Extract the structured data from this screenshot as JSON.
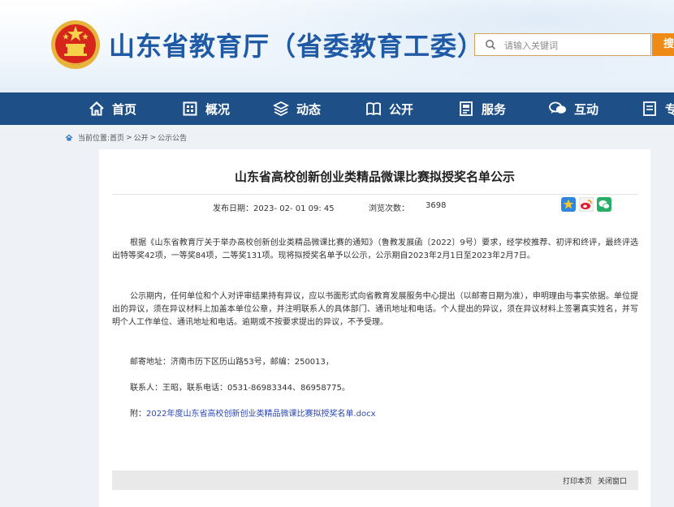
{
  "header": {
    "site_title": "山东省教育厅（省委教育工委）",
    "search_placeholder": "请输入关键词",
    "search_button": "搜"
  },
  "nav": {
    "items": [
      {
        "label": "首页",
        "icon": "home-icon"
      },
      {
        "label": "概况",
        "icon": "building-icon"
      },
      {
        "label": "动态",
        "icon": "layers-icon"
      },
      {
        "label": "公开",
        "icon": "book-icon"
      },
      {
        "label": "服务",
        "icon": "document-icon"
      },
      {
        "label": "互动",
        "icon": "chat-icon"
      },
      {
        "label": "专",
        "icon": "list-icon"
      }
    ]
  },
  "breadcrumb": {
    "prefix": "当前位置:",
    "items": [
      "首页",
      "公开",
      "公示公告"
    ],
    "separator": ">"
  },
  "article": {
    "title": "山东省高校创新创业类精品微课比赛拟授奖名单公示",
    "publish_label": "发布日期：",
    "publish_date": "2023- 02- 01 09: 45",
    "views_label": "浏览次数：",
    "views": "3698",
    "share_icons": [
      "qzone-icon",
      "weibo-icon",
      "wechat-icon"
    ],
    "para1": "根据《山东省教育厅关于举办高校创新创业类精品微课比赛的通知》（鲁教发展函〔2022〕9号）要求，经学校推荐、初评和终评，最终评选出特等奖42项，一等奖84项，二等奖131项。现将拟授奖名单予以公示，公示期自2023年2月1日至2023年2月7日。",
    "para2": "公示期内，任何单位和个人对评审结果持有异议，应以书面形式向省教育发展服务中心提出（以邮寄日期为准），申明理由与事实依据。单位提出的异议，须在异议材料上加盖本单位公章，并注明联系人的具体部门、通讯地址和电话。个人提出的异议，须在异议材料上签署真实姓名，并写明个人工作单位、通讯地址和电话。逾期或不按要求提出的异议，不予受理。",
    "mail": "邮寄地址：济南市历下区历山路53号，邮编：250013，",
    "contact": "联系人：王昭，联系电话：0531-86983344、86958775。",
    "attach_prefix": "附：",
    "attach_link": "2022年度山东省高校创新创业类精品微课比赛拟授奖名单.docx",
    "print_label": "打印本页",
    "close_label": "关闭窗口"
  },
  "colors": {
    "nav_bg": "#1e4f86",
    "title_blue": "#1f5aa6",
    "search_orange": "#f08a16",
    "link_blue": "#2b47b5"
  }
}
